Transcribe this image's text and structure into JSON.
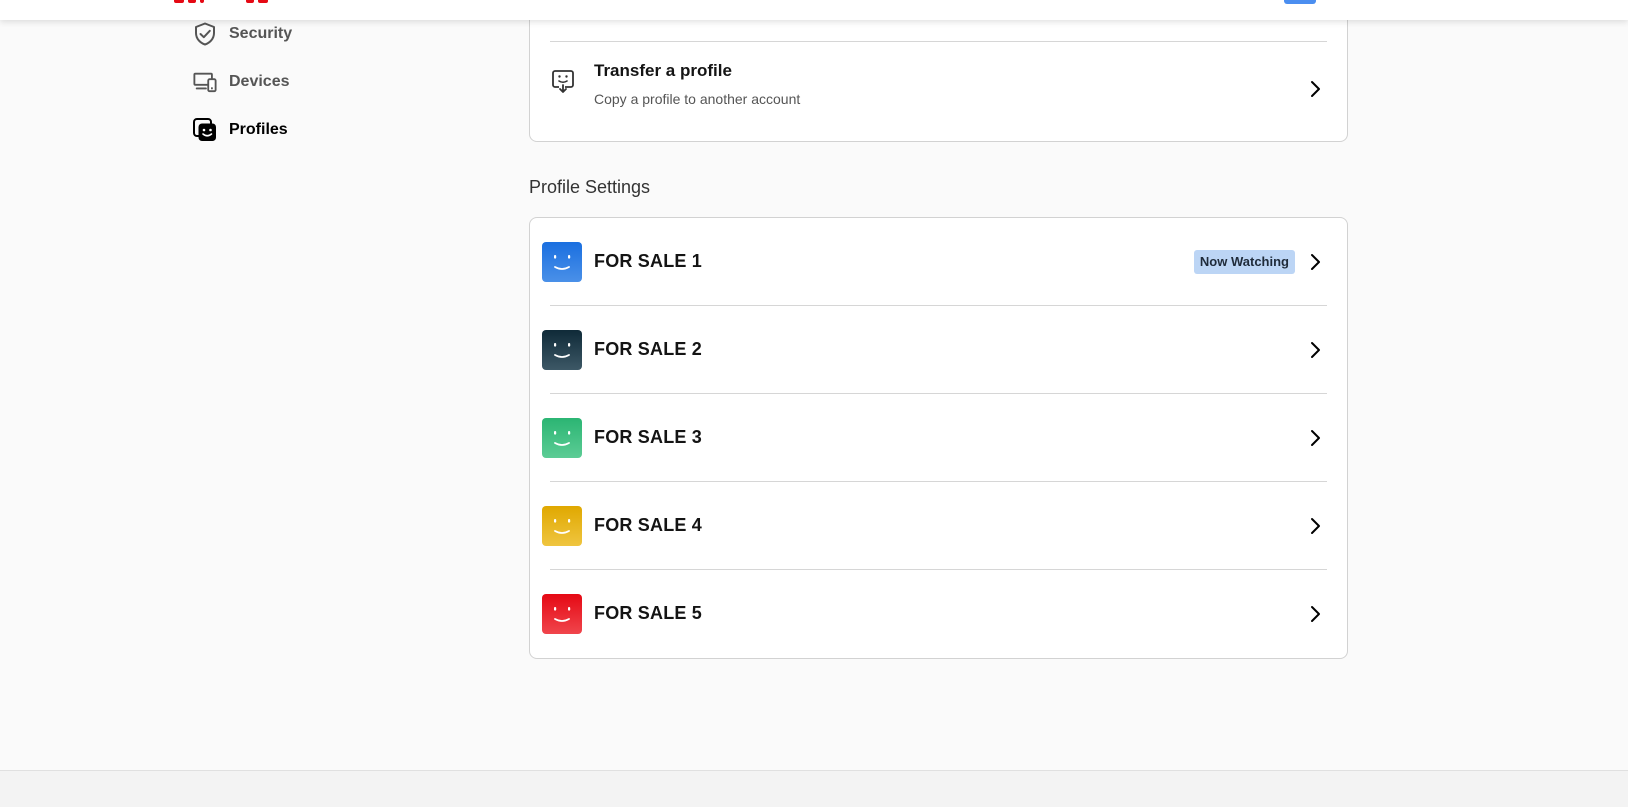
{
  "sidebar": {
    "items": [
      {
        "label": "Security",
        "icon": "shield-check-icon",
        "active": false
      },
      {
        "label": "Devices",
        "icon": "devices-icon",
        "active": false
      },
      {
        "label": "Profiles",
        "icon": "profiles-icon",
        "active": true
      }
    ]
  },
  "transfer": {
    "title": "Transfer a profile",
    "subtitle": "Copy a profile to another account",
    "icon": "transfer-profile-icon"
  },
  "profile_settings": {
    "heading": "Profile Settings",
    "profiles": [
      {
        "name": "FOR SALE 1",
        "color_top": "#1a6fe0",
        "color_bottom": "#4a90e8",
        "badge": "Now Watching"
      },
      {
        "name": "FOR SALE 2",
        "color_top": "#0f2a38",
        "color_bottom": "#3d5866",
        "badge": null
      },
      {
        "name": "FOR SALE 3",
        "color_top": "#2bb573",
        "color_bottom": "#5ccc95",
        "badge": null
      },
      {
        "name": "FOR SALE 4",
        "color_top": "#e0a800",
        "color_bottom": "#efc540",
        "badge": null
      },
      {
        "name": "FOR SALE 5",
        "color_top": "#e50914",
        "color_bottom": "#f0454c",
        "badge": null
      }
    ]
  },
  "colors": {
    "brand": "#e50914",
    "badge_bg": "#bcd5f5",
    "border": "#d2d2d2",
    "page_bg": "#fafafa"
  }
}
